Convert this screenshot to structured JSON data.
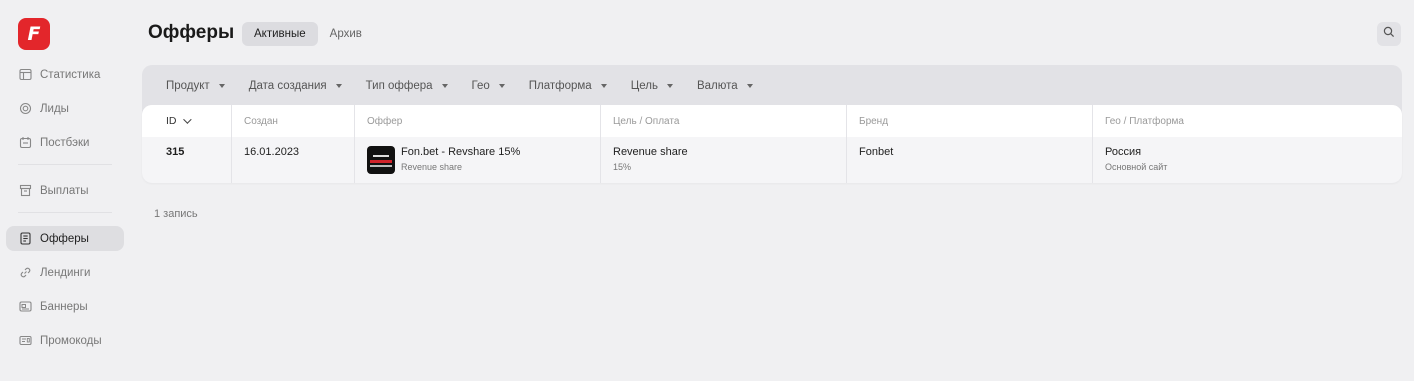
{
  "logo": {
    "letter": "F",
    "color": "#e3262b"
  },
  "sidebar": {
    "items": [
      {
        "label": "Статистика",
        "icon": "stats-icon"
      },
      {
        "label": "Лиды",
        "icon": "target-icon"
      },
      {
        "label": "Постбэки",
        "icon": "postback-icon"
      },
      {
        "label": "Выплаты",
        "icon": "payouts-icon"
      },
      {
        "label": "Офферы",
        "icon": "offers-icon",
        "active": true
      },
      {
        "label": "Лендинги",
        "icon": "link-icon"
      },
      {
        "label": "Баннеры",
        "icon": "banner-icon"
      },
      {
        "label": "Промокоды",
        "icon": "promocode-icon"
      }
    ]
  },
  "header": {
    "title": "Офферы",
    "tabs": [
      {
        "label": "Активные",
        "active": true
      },
      {
        "label": "Архив",
        "active": false
      }
    ],
    "search_icon": "search-icon"
  },
  "filters": [
    {
      "label": "Продукт"
    },
    {
      "label": "Дата создания"
    },
    {
      "label": "Тип оффера"
    },
    {
      "label": "Гео"
    },
    {
      "label": "Платформа"
    },
    {
      "label": "Цель"
    },
    {
      "label": "Валюта"
    }
  ],
  "table": {
    "columns": [
      "ID",
      "Создан",
      "Оффер",
      "Цель / Оплата",
      "Бренд",
      "Гео / Платформа"
    ],
    "rows": [
      {
        "id": "315",
        "created": "16.01.2023",
        "offer_title": "Fon.bet - Revshare 15%",
        "offer_sub": "Revenue share",
        "goal": "Revenue share",
        "goal_sub": "15%",
        "brand": "Fonbet",
        "geo": "Россия",
        "platform": "Основной сайт"
      }
    ]
  },
  "footer": {
    "records": "1 запись"
  }
}
